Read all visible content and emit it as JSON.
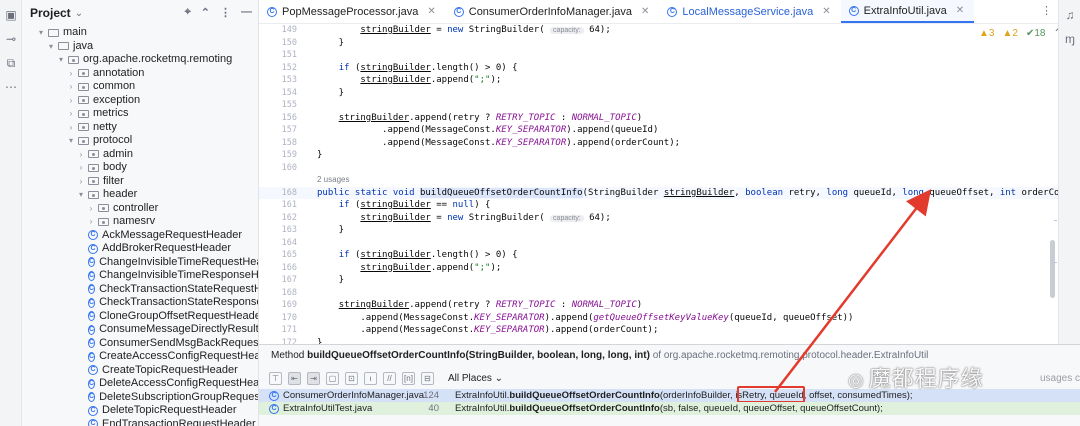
{
  "project_panel": {
    "title": "Project",
    "tree": [
      {
        "label": "main",
        "indent": 2,
        "kind": "folder",
        "arrow": "▾"
      },
      {
        "label": "java",
        "indent": 3,
        "kind": "folder",
        "arrow": "▾"
      },
      {
        "label": "org.apache.rocketmq.remoting",
        "indent": 4,
        "kind": "pkg",
        "arrow": "▾"
      },
      {
        "label": "annotation",
        "indent": 5,
        "kind": "pkg",
        "arrow": "›"
      },
      {
        "label": "common",
        "indent": 5,
        "kind": "pkg",
        "arrow": "›"
      },
      {
        "label": "exception",
        "indent": 5,
        "kind": "pkg",
        "arrow": "›"
      },
      {
        "label": "metrics",
        "indent": 5,
        "kind": "pkg",
        "arrow": "›"
      },
      {
        "label": "netty",
        "indent": 5,
        "kind": "pkg",
        "arrow": "›"
      },
      {
        "label": "protocol",
        "indent": 5,
        "kind": "pkg",
        "arrow": "▾"
      },
      {
        "label": "admin",
        "indent": 6,
        "kind": "pkg",
        "arrow": "›"
      },
      {
        "label": "body",
        "indent": 6,
        "kind": "pkg",
        "arrow": "›"
      },
      {
        "label": "filter",
        "indent": 6,
        "kind": "pkg",
        "arrow": "›"
      },
      {
        "label": "header",
        "indent": 6,
        "kind": "pkg",
        "arrow": "▾"
      },
      {
        "label": "controller",
        "indent": 7,
        "kind": "pkg",
        "arrow": "›"
      },
      {
        "label": "namesrv",
        "indent": 7,
        "kind": "pkg",
        "arrow": "›"
      },
      {
        "label": "AckMessageRequestHeader",
        "indent": 7,
        "kind": "class"
      },
      {
        "label": "AddBrokerRequestHeader",
        "indent": 7,
        "kind": "class"
      },
      {
        "label": "ChangeInvisibleTimeRequestHea",
        "indent": 7,
        "kind": "class"
      },
      {
        "label": "ChangeInvisibleTimeResponseHe",
        "indent": 7,
        "kind": "class"
      },
      {
        "label": "CheckTransactionStateRequestH",
        "indent": 7,
        "kind": "class"
      },
      {
        "label": "CheckTransactionStateResponse",
        "indent": 7,
        "kind": "class"
      },
      {
        "label": "CloneGroupOffsetRequestHeade",
        "indent": 7,
        "kind": "class"
      },
      {
        "label": "ConsumeMessageDirectlyResultI",
        "indent": 7,
        "kind": "class"
      },
      {
        "label": "ConsumerSendMsgBackRequest",
        "indent": 7,
        "kind": "class"
      },
      {
        "label": "CreateAccessConfigRequestHea",
        "indent": 7,
        "kind": "class"
      },
      {
        "label": "CreateTopicRequestHeader",
        "indent": 7,
        "kind": "class"
      },
      {
        "label": "DeleteAccessConfigRequestHea",
        "indent": 7,
        "kind": "class"
      },
      {
        "label": "DeleteSubscriptionGroupReques",
        "indent": 7,
        "kind": "class"
      },
      {
        "label": "DeleteTopicRequestHeader",
        "indent": 7,
        "kind": "class"
      },
      {
        "label": "EndTransactionRequestHeader",
        "indent": 7,
        "kind": "class"
      }
    ]
  },
  "tabs": [
    {
      "label": "PopMessageProcessor.java",
      "style": ""
    },
    {
      "label": "ConsumerOrderInfoManager.java",
      "style": ""
    },
    {
      "label": "LocalMessageService.java",
      "style": "blue"
    },
    {
      "label": "ExtraInfoUtil.java",
      "style": "active"
    }
  ],
  "inspections": {
    "warnings": "▲3",
    "weak": "▲2",
    "ok": "✔18"
  },
  "code_lines": [
    {
      "n": "149",
      "html": "        <span class=\"ul\">stringBuilder</span> = <span class=\"kw\">new</span> StringBuilder( <span class=\"hint\">capacity:</span> 64);"
    },
    {
      "n": "150",
      "html": "    }"
    },
    {
      "n": "151",
      "html": ""
    },
    {
      "n": "152",
      "html": "    <span class=\"kw\">if</span> (<span class=\"ul\">stringBuilder</span>.length() &gt; 0) {"
    },
    {
      "n": "153",
      "html": "        <span class=\"ul\">stringBuilder</span>.append(<span class=\"st\">\";\"</span>);"
    },
    {
      "n": "154",
      "html": "    }"
    },
    {
      "n": "155",
      "html": ""
    },
    {
      "n": "156",
      "html": "    <span class=\"ul\">stringBuilder</span>.append(retry ? <span class=\"it\">RETRY_TOPIC</span> : <span class=\"it\">NORMAL_TOPIC</span>)"
    },
    {
      "n": "157",
      "html": "            .append(MessageConst.<span class=\"it\">KEY_SEPARATOR</span>).append(queueId)"
    },
    {
      "n": "158",
      "html": "            .append(MessageConst.<span class=\"it\">KEY_SEPARATOR</span>).append(orderCount);"
    },
    {
      "n": "159",
      "html": "}"
    },
    {
      "n": "160",
      "html": ""
    },
    {
      "n": "",
      "html": "<span class=\"usages\">2 usages</span>"
    },
    {
      "n": "168",
      "hl": true,
      "html": "<span class=\"kw\">public static void</span> <span class=\"selected-name\">buildQueueOffsetOrderCountInfo</span>(StringBuilder <span class=\"ul\">stringBuilder</span>, <span class=\"kw\">boolean</span> retry, <span class=\"kw\">long</span> queueId, <span class=\"kw\">long</span> queueOffset, <span class=\"kw\">int</span> orderCount) {"
    },
    {
      "n": "161",
      "html": "    <span class=\"kw\">if</span> (<span class=\"ul\">stringBuilder</span> == <span class=\"kw\">null</span>) {"
    },
    {
      "n": "162",
      "html": "        <span class=\"ul\">stringBuilder</span> = <span class=\"kw\">new</span> StringBuilder( <span class=\"hint\">capacity:</span> 64);"
    },
    {
      "n": "163",
      "html": "    }"
    },
    {
      "n": "164",
      "html": ""
    },
    {
      "n": "165",
      "html": "    <span class=\"kw\">if</span> (<span class=\"ul\">stringBuilder</span>.length() &gt; 0) {"
    },
    {
      "n": "166",
      "html": "        <span class=\"ul\">stringBuilder</span>.append(<span class=\"st\">\";\"</span>);"
    },
    {
      "n": "167",
      "html": "    }"
    },
    {
      "n": "168",
      "html": ""
    },
    {
      "n": "169",
      "html": "    <span class=\"ul\">stringBuilder</span>.append(retry ? <span class=\"it\">RETRY_TOPIC</span> : <span class=\"it\">NORMAL_TOPIC</span>)"
    },
    {
      "n": "170",
      "html": "        .append(MessageConst.<span class=\"it\">KEY_SEPARATOR</span>).append(<span class=\"it\">getQueueOffsetKeyValueKey</span>(queueId, queueOffset))"
    },
    {
      "n": "171",
      "html": "        .append(MessageConst.<span class=\"it\">KEY_SEPARATOR</span>).append(orderCount);"
    },
    {
      "n": "172",
      "html": "}"
    }
  ],
  "popup": {
    "method_label": "Method",
    "method_sig": "buildQueueOffsetOrderCountInfo(StringBuilder, boolean, long, long, int)",
    "of_text": "of",
    "package": "org.apache.rocketmq.remoting.protocol.header.ExtraInfoUtil",
    "places": "All Places ⌄",
    "more_hint": "usages c",
    "usages": [
      {
        "file": "ConsumerOrderInfoManager.java",
        "line": "124",
        "prefix": "ExtraInfoUtil.",
        "method": "buildQueueOffsetOrderCountInfo",
        "args": "(orderInfoBuilder, isRetry, queueId, offset, consumedTimes);",
        "selected": true
      },
      {
        "file": "ExtraInfoUtilTest.java",
        "line": "40",
        "prefix": "ExtraInfoUtil.",
        "method": "buildQueueOffsetOrderCountInfo",
        "args": "(sb, false, queueId, queueOffset, queueOffsetCount);",
        "selected": false
      }
    ]
  },
  "watermark": "魔都程序缘"
}
